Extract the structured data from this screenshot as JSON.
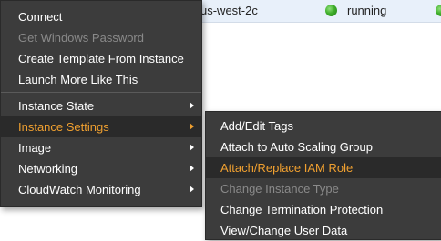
{
  "table_row": {
    "zone": "us-west-2c",
    "state": "running"
  },
  "context_menu": {
    "items": [
      {
        "label": "Connect"
      },
      {
        "label": "Get Windows Password"
      },
      {
        "label": "Create Template From Instance"
      },
      {
        "label": "Launch More Like This"
      },
      {
        "label": "Instance State"
      },
      {
        "label": "Instance Settings"
      },
      {
        "label": "Image"
      },
      {
        "label": "Networking"
      },
      {
        "label": "CloudWatch Monitoring"
      }
    ]
  },
  "submenu": {
    "items": [
      {
        "label": "Add/Edit Tags"
      },
      {
        "label": "Attach to Auto Scaling Group"
      },
      {
        "label": "Attach/Replace IAM Role"
      },
      {
        "label": "Change Instance Type"
      },
      {
        "label": "Change Termination Protection"
      },
      {
        "label": "View/Change User Data"
      }
    ]
  },
  "colors": {
    "menu_bg": "#3c3c3c",
    "highlight_text": "#f0a030",
    "disabled_text": "#8a8a8a",
    "running_status": "#3fae2a"
  }
}
